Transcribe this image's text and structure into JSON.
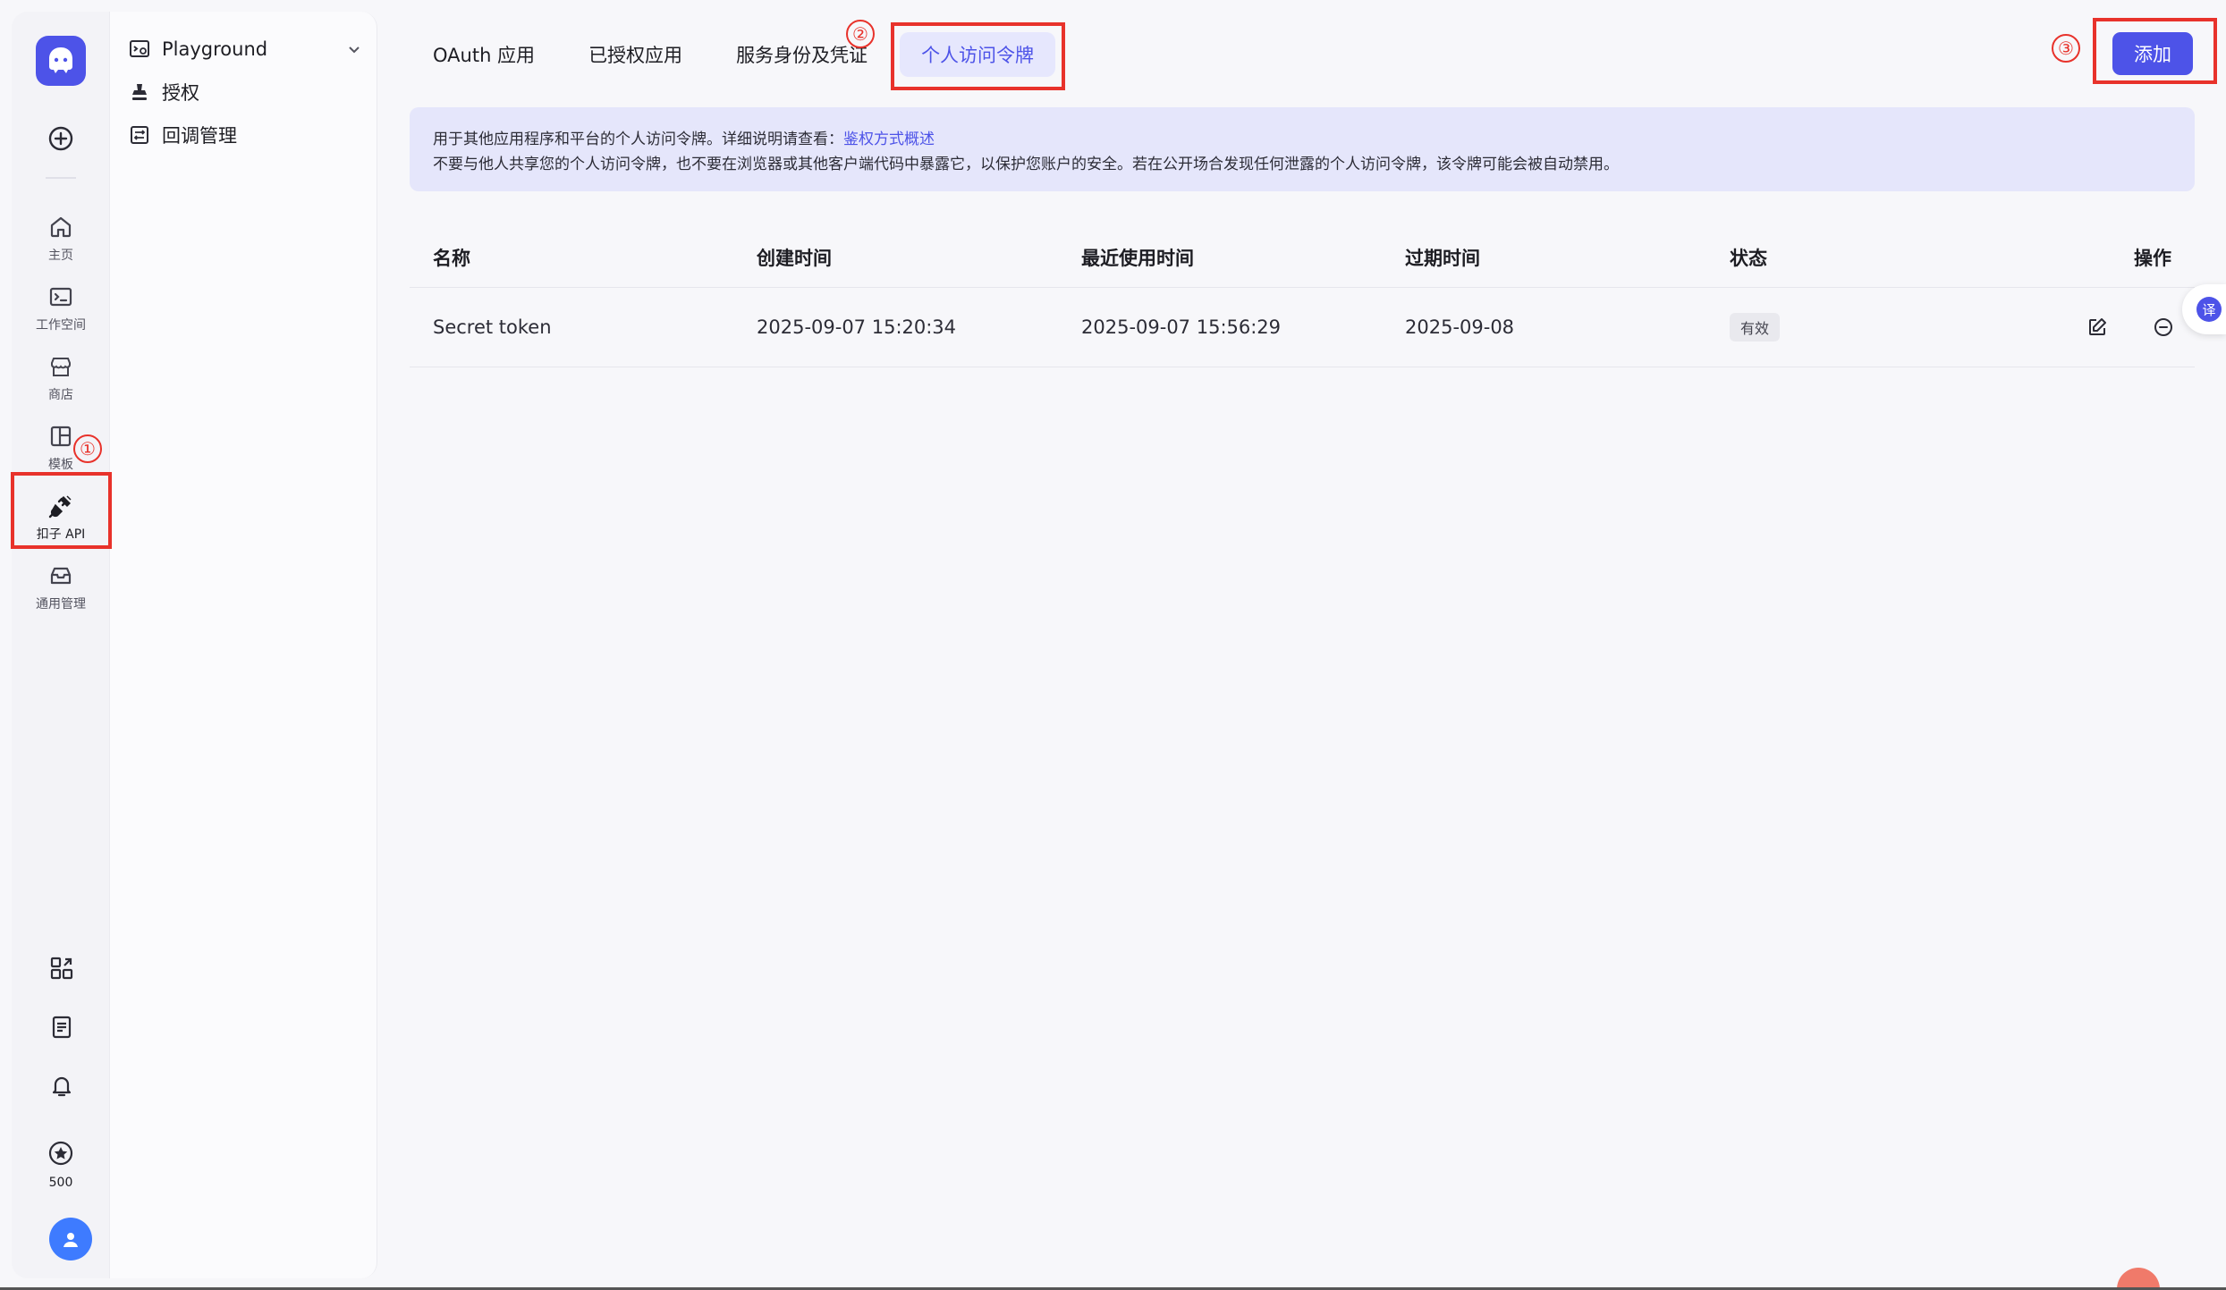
{
  "rail": {
    "items": [
      {
        "label": "主页",
        "icon": "home-icon"
      },
      {
        "label": "工作空间",
        "icon": "terminal-folder-icon"
      },
      {
        "label": "商店",
        "icon": "store-icon"
      },
      {
        "label": "模板",
        "icon": "template-icon"
      },
      {
        "label": "扣子 API",
        "icon": "plug-icon"
      },
      {
        "label": "通用管理",
        "icon": "inbox-icon"
      }
    ],
    "credits": "500"
  },
  "panel": {
    "items": [
      {
        "label": "Playground",
        "icon": "playground-icon"
      },
      {
        "label": "授权",
        "icon": "stamp-icon"
      },
      {
        "label": "回调管理",
        "icon": "callback-icon"
      }
    ]
  },
  "tabs": [
    {
      "label": "OAuth 应用"
    },
    {
      "label": "已授权应用"
    },
    {
      "label": "服务身份及凭证"
    },
    {
      "label": "个人访问令牌"
    }
  ],
  "actions": {
    "add_label": "添加"
  },
  "banner": {
    "line1_prefix": "用于其他应用程序和平台的个人访问令牌。详细说明请查看：",
    "line1_link": "鉴权方式概述",
    "line2": "不要与他人共享您的个人访问令牌，也不要在浏览器或其他客户端代码中暴露它，以保护您账户的安全。若在公开场合发现任何泄露的个人访问令牌，该令牌可能会被自动禁用。"
  },
  "table": {
    "columns": [
      "名称",
      "创建时间",
      "最近使用时间",
      "过期时间",
      "状态",
      "操作"
    ],
    "rows": [
      {
        "name": "Secret token",
        "created": "2025-09-07 15:20:34",
        "last_used": "2025-09-07 15:56:29",
        "expires": "2025-09-08",
        "status": "有效"
      }
    ]
  },
  "annotations": [
    "①",
    "②",
    "③"
  ],
  "translate_label": "译",
  "colors": {
    "accent": "#4d53e8",
    "annotation": "#e8322b",
    "banner_bg": "#e5e6fb"
  }
}
